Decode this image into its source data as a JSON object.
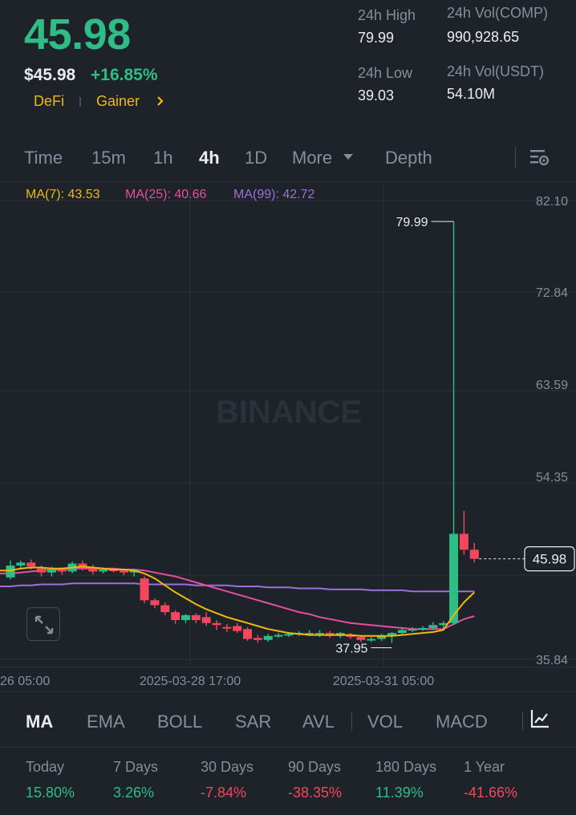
{
  "ticker": {
    "last_price": "45.98",
    "usd_price": "$45.98",
    "change_pct": "+16.85%",
    "tags": [
      "DeFi",
      "Gainer"
    ]
  },
  "stats": {
    "high_label": "24h High",
    "high_value": "79.99",
    "low_label": "24h Low",
    "low_value": "39.03",
    "vol_comp_label": "24h Vol(COMP)",
    "vol_comp_value": "990,928.65",
    "vol_usdt_label": "24h Vol(USDT)",
    "vol_usdt_value": "54.10M"
  },
  "interval_tabs": [
    "Time",
    "15m",
    "1h",
    "4h",
    "1D",
    "More",
    "Depth"
  ],
  "active_interval": "4h",
  "ma_legend": {
    "ma7": "MA(7): 43.53",
    "ma25": "MA(25): 40.66",
    "ma99": "MA(99): 42.72"
  },
  "indicator_tabs": [
    "MA",
    "EMA",
    "BOLL",
    "SAR",
    "AVL",
    "VOL",
    "MACD"
  ],
  "active_indicator": "MA",
  "performance": [
    {
      "label": "Today",
      "value": "15.80%",
      "dir": "up"
    },
    {
      "label": "7 Days",
      "value": "3.26%",
      "dir": "up"
    },
    {
      "label": "30 Days",
      "value": "-7.84%",
      "dir": "down"
    },
    {
      "label": "90 Days",
      "value": "-38.35%",
      "dir": "down"
    },
    {
      "label": "180 Days",
      "value": "11.39%",
      "dir": "up"
    },
    {
      "label": "1 Year",
      "value": "-41.66%",
      "dir": "down"
    }
  ],
  "colors": {
    "up": "#2ebd85",
    "down": "#f6465d",
    "ma7": "#f0b90b",
    "ma25": "#e84da2",
    "ma99": "#9c6fdc",
    "accent": "#f0b90b"
  },
  "watermark": "BINANCE",
  "chart_data": {
    "type": "candlestick",
    "y_ticks": [
      "82.10",
      "72.84",
      "63.59",
      "54.35",
      "45.98",
      "35.84"
    ],
    "ylim": [
      35.84,
      82.1
    ],
    "x_ticks": [
      "26 05:00",
      "2025-03-28 17:00",
      "2025-03-31 05:00"
    ],
    "current_price_label": "45.98",
    "high_marker": "79.99",
    "low_marker": "37.95",
    "candles": [
      [
        44.1,
        45.3,
        43.9,
        45.8
      ],
      [
        45.3,
        45.6,
        44.9,
        45.8
      ],
      [
        45.6,
        45.2,
        44.9,
        45.9
      ],
      [
        45.0,
        44.6,
        44.2,
        45.3
      ],
      [
        44.6,
        44.9,
        44.2,
        45.2
      ],
      [
        44.9,
        44.7,
        44.4,
        45.1
      ],
      [
        44.7,
        45.5,
        44.5,
        45.7
      ],
      [
        45.5,
        45.0,
        44.8,
        45.8
      ],
      [
        45.0,
        44.7,
        44.4,
        45.4
      ],
      [
        44.7,
        44.9,
        44.5,
        45.1
      ],
      [
        44.9,
        44.8,
        44.6,
        45.1
      ],
      [
        44.8,
        44.6,
        44.3,
        45.0
      ],
      [
        44.6,
        44.9,
        44.2,
        45.0
      ],
      [
        44.0,
        41.8,
        41.5,
        44.2
      ],
      [
        41.8,
        41.3,
        41.0,
        42.0
      ],
      [
        41.3,
        40.6,
        40.3,
        41.6
      ],
      [
        40.6,
        39.8,
        39.4,
        40.8
      ],
      [
        39.8,
        40.3,
        39.5,
        40.4
      ],
      [
        40.3,
        39.8,
        39.5,
        40.5
      ],
      [
        40.1,
        39.5,
        39.2,
        40.6
      ],
      [
        39.5,
        39.3,
        38.8,
        39.8
      ],
      [
        39.1,
        39.0,
        38.6,
        39.4
      ],
      [
        39.2,
        38.7,
        38.5,
        39.5
      ],
      [
        38.9,
        37.9,
        37.7,
        39.1
      ],
      [
        38.0,
        37.8,
        37.5,
        38.3
      ],
      [
        37.8,
        38.2,
        37.6,
        38.4
      ],
      [
        38.2,
        38.3,
        38.0,
        38.5
      ],
      [
        38.3,
        38.4,
        38.1,
        38.6
      ],
      [
        38.4,
        38.5,
        38.2,
        38.7
      ],
      [
        38.5,
        38.5,
        38.2,
        38.8
      ],
      [
        38.4,
        38.5,
        38.1,
        38.8
      ],
      [
        38.5,
        38.2,
        38.0,
        38.7
      ],
      [
        38.2,
        38.5,
        38.0,
        38.6
      ],
      [
        38.3,
        38.1,
        37.9,
        38.5
      ],
      [
        38.1,
        37.8,
        37.6,
        38.3
      ],
      [
        37.8,
        37.9,
        37.6,
        38.1
      ],
      [
        37.9,
        38.2,
        37.7,
        38.4
      ],
      [
        38.2,
        38.5,
        37.5,
        38.6
      ],
      [
        38.5,
        38.8,
        38.3,
        39.0
      ],
      [
        38.8,
        38.9,
        38.6,
        39.1
      ],
      [
        38.9,
        39.0,
        38.7,
        39.2
      ],
      [
        39.0,
        39.3,
        38.8,
        39.6
      ],
      [
        39.3,
        39.5,
        39.0,
        39.7
      ],
      [
        39.5,
        48.5,
        39.3,
        79.99
      ],
      [
        48.5,
        46.9,
        46.4,
        50.8
      ],
      [
        46.9,
        45.98,
        45.6,
        47.6
      ]
    ],
    "ma7": [
      44.8,
      45.0,
      45.1,
      45.1,
      45.0,
      45.0,
      45.1,
      45.2,
      45.1,
      45.0,
      44.9,
      44.9,
      44.8,
      44.5,
      44.0,
      43.3,
      42.6,
      42.0,
      41.4,
      40.9,
      40.5,
      40.1,
      39.8,
      39.5,
      39.2,
      38.9,
      38.7,
      38.5,
      38.4,
      38.3,
      38.3,
      38.3,
      38.3,
      38.3,
      38.2,
      38.2,
      38.2,
      38.2,
      38.3,
      38.4,
      38.5,
      38.6,
      38.8,
      40.3,
      41.6,
      42.6
    ],
    "ma25": [
      44.5,
      44.6,
      44.7,
      44.8,
      44.9,
      44.9,
      45.0,
      45.0,
      45.0,
      45.0,
      45.0,
      44.9,
      44.9,
      44.8,
      44.6,
      44.4,
      44.2,
      43.9,
      43.6,
      43.3,
      43.0,
      42.7,
      42.4,
      42.1,
      41.8,
      41.5,
      41.2,
      40.9,
      40.6,
      40.4,
      40.1,
      39.9,
      39.7,
      39.5,
      39.4,
      39.3,
      39.2,
      39.1,
      39.0,
      38.9,
      38.9,
      38.9,
      38.9,
      39.4,
      39.9,
      40.2
    ],
    "ma99": [
      43.2,
      43.3,
      43.3,
      43.4,
      43.4,
      43.4,
      43.5,
      43.5,
      43.5,
      43.5,
      43.5,
      43.5,
      43.5,
      43.4,
      43.4,
      43.4,
      43.4,
      43.4,
      43.3,
      43.3,
      43.3,
      43.3,
      43.2,
      43.2,
      43.2,
      43.1,
      43.1,
      43.1,
      43.0,
      43.0,
      43.0,
      42.9,
      42.9,
      42.9,
      42.9,
      42.8,
      42.8,
      42.8,
      42.8,
      42.7,
      42.7,
      42.7,
      42.7,
      42.7,
      42.7,
      42.7
    ]
  }
}
